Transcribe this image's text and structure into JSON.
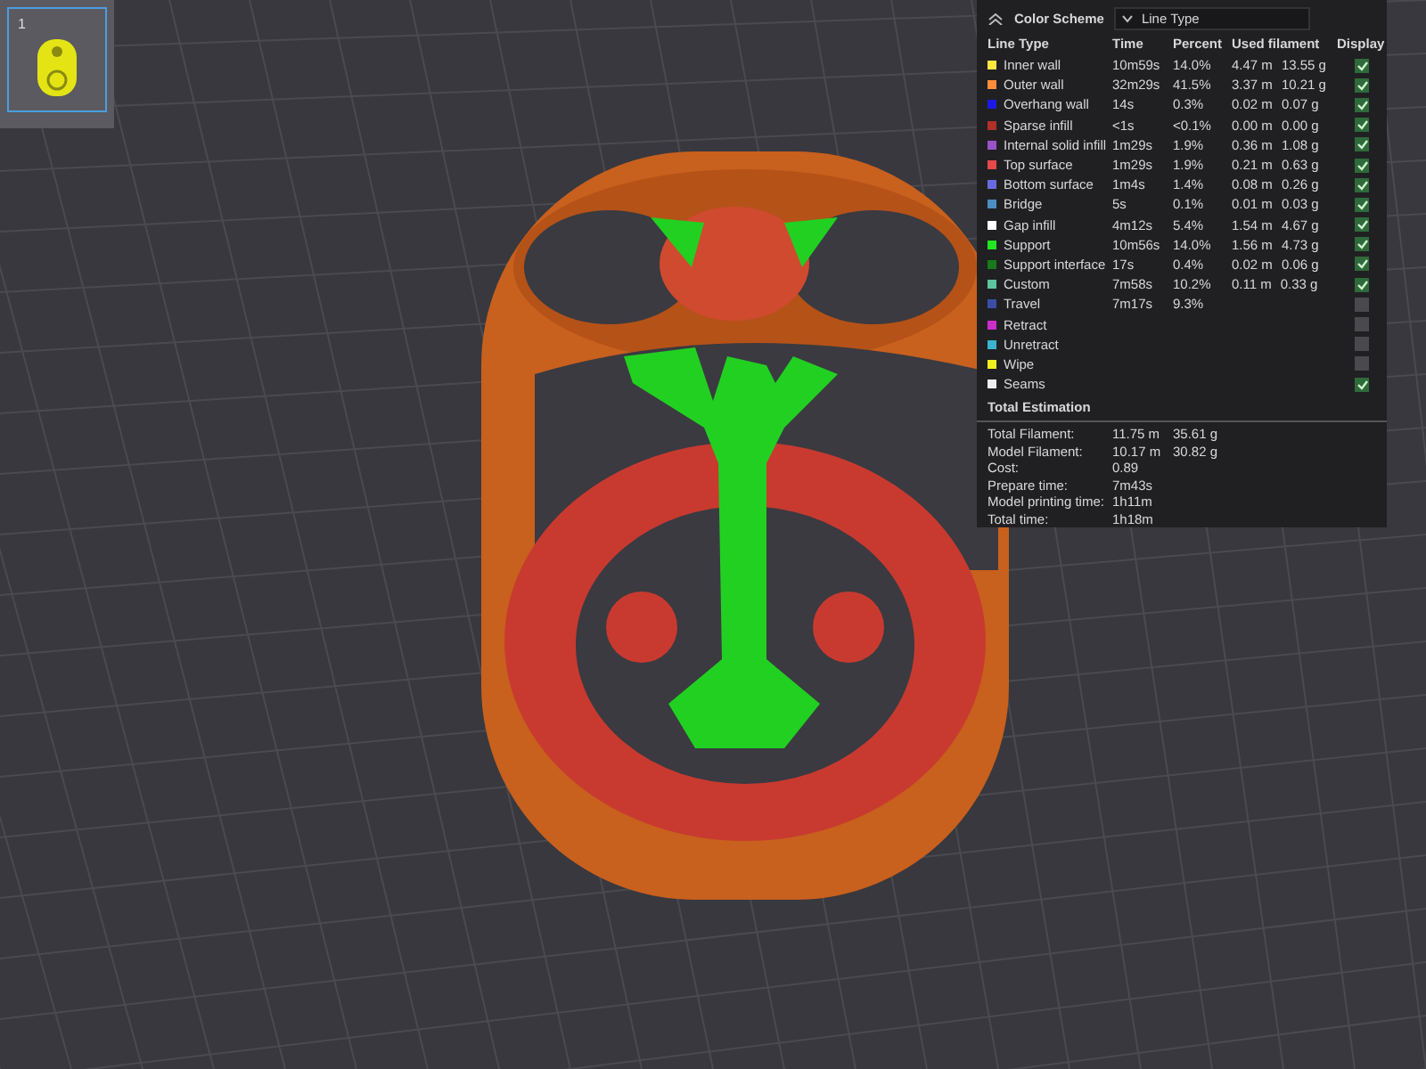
{
  "plate": {
    "number": "1",
    "selected": true
  },
  "legend": {
    "title": "Color Scheme",
    "scheme": "Line Type",
    "columns": [
      "Line Type",
      "Time",
      "Percent",
      "Used filament",
      "Display"
    ],
    "rows": [
      {
        "name": "Inner wall",
        "color": "#ffe640",
        "time": "10m59s",
        "percent": "14.0%",
        "used_m": "4.47 m",
        "used_g": "13.55 g",
        "checked": true
      },
      {
        "name": "Outer wall",
        "color": "#ff8c3a",
        "time": "32m29s",
        "percent": "41.5%",
        "used_m": "3.37 m",
        "used_g": "10.21 g",
        "checked": true
      },
      {
        "name": "Overhang wall",
        "color": "#1a1ae6",
        "time": "14s",
        "percent": "0.3%",
        "used_m": "0.02 m",
        "used_g": "0.07 g",
        "checked": true
      },
      {
        "name": "Sparse infill",
        "color": "#b0302a",
        "time": "<1s",
        "percent": "<0.1%",
        "used_m": "0.00 m",
        "used_g": "0.00 g",
        "checked": true
      },
      {
        "name": "Internal solid infill",
        "color": "#9a52c8",
        "time": "1m29s",
        "percent": "1.9%",
        "used_m": "0.36 m",
        "used_g": "1.08 g",
        "checked": true
      },
      {
        "name": "Top surface",
        "color": "#e84848",
        "time": "1m29s",
        "percent": "1.9%",
        "used_m": "0.21 m",
        "used_g": "0.63 g",
        "checked": true
      },
      {
        "name": "Bottom surface",
        "color": "#6a6ae0",
        "time": "1m4s",
        "percent": "1.4%",
        "used_m": "0.08 m",
        "used_g": "0.26 g",
        "checked": true
      },
      {
        "name": "Bridge",
        "color": "#4a8ec2",
        "time": "5s",
        "percent": "0.1%",
        "used_m": "0.01 m",
        "used_g": "0.03 g",
        "checked": true
      },
      {
        "name": "Gap infill",
        "color": "#ffffff",
        "time": "4m12s",
        "percent": "5.4%",
        "used_m": "1.54 m",
        "used_g": "4.67 g",
        "checked": true
      },
      {
        "name": "Support",
        "color": "#22e622",
        "time": "10m56s",
        "percent": "14.0%",
        "used_m": "1.56 m",
        "used_g": "4.73 g",
        "checked": true
      },
      {
        "name": "Support interface",
        "color": "#187a18",
        "time": "17s",
        "percent": "0.4%",
        "used_m": "0.02 m",
        "used_g": "0.06 g",
        "checked": true
      },
      {
        "name": "Custom",
        "color": "#5ec4a0",
        "time": "7m58s",
        "percent": "10.2%",
        "used_m": "0.11 m",
        "used_g": "0.33 g",
        "checked": true
      },
      {
        "name": "Travel",
        "color": "#3a4ea8",
        "time": "7m17s",
        "percent": "9.3%",
        "checked": false
      },
      {
        "name": "Retract",
        "color": "#cc2ecc",
        "checked": false
      },
      {
        "name": "Unretract",
        "color": "#3ab4d0",
        "checked": false
      },
      {
        "name": "Wipe",
        "color": "#f0f020",
        "checked": false
      },
      {
        "name": "Seams",
        "color": "#eeeeee",
        "checked": true
      }
    ]
  },
  "estimation": {
    "title": "Total Estimation",
    "rows": [
      {
        "label": "Total Filament:",
        "value": "11.75 m",
        "extra": "35.61 g"
      },
      {
        "label": "Model Filament:",
        "value": "10.17 m",
        "extra": "30.82 g"
      },
      {
        "label": "Cost:",
        "value": "0.89"
      },
      {
        "label": "Prepare time:",
        "value": "7m43s"
      },
      {
        "label": "Model printing time:",
        "value": "1h11m"
      },
      {
        "label": "Total time:",
        "value": "1h18m"
      }
    ]
  }
}
